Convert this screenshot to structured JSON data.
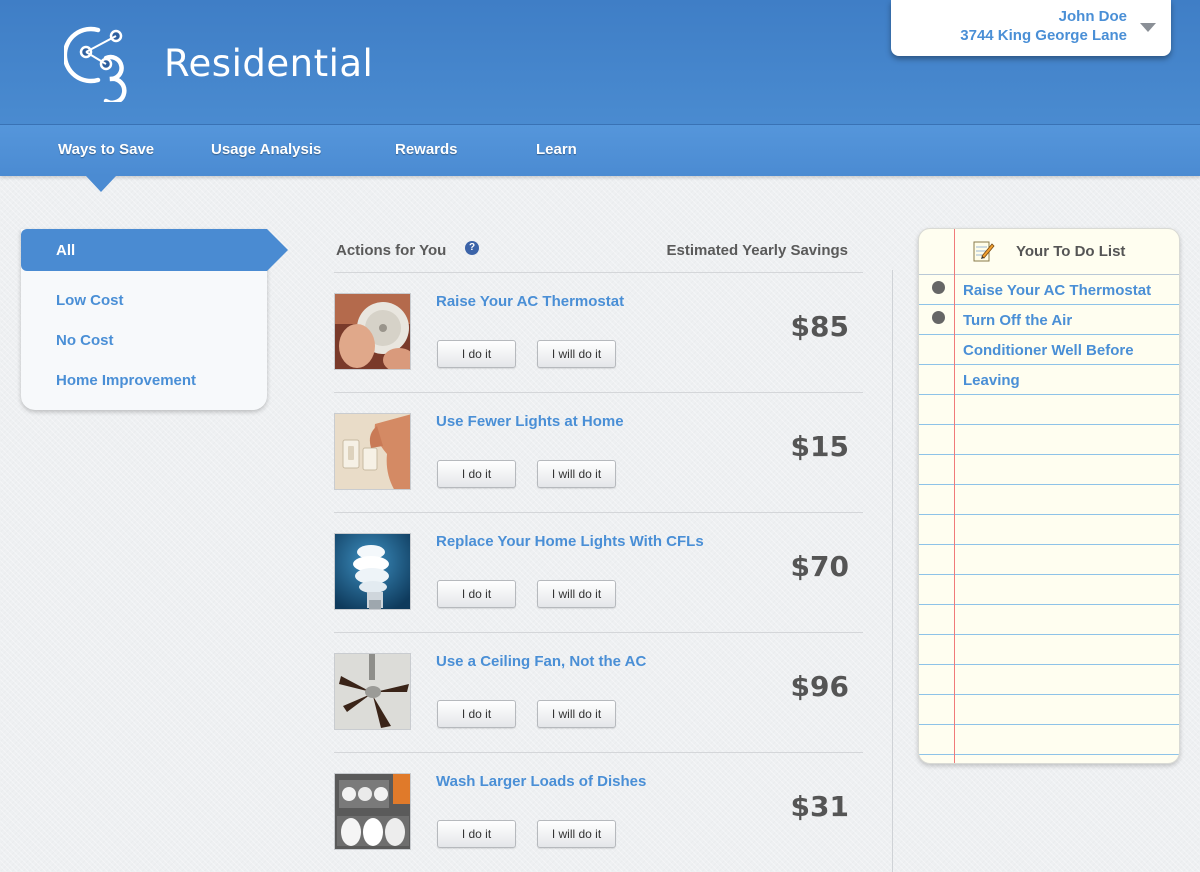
{
  "header": {
    "brand": "Residential",
    "user_name": "John Doe",
    "user_address": "3744 King George Lane"
  },
  "nav": {
    "items": [
      "Ways to Save",
      "Usage Analysis",
      "Rewards",
      "Learn"
    ],
    "active": "Ways to Save"
  },
  "filters": {
    "items": [
      "All",
      "Low Cost",
      "No Cost",
      "Home Improvement"
    ],
    "selected": "All"
  },
  "actions": {
    "header": "Actions for You",
    "savings_header": "Estimated Yearly Savings",
    "do_label": "I do it",
    "will_label": "I will do it",
    "items": [
      {
        "title": "Raise Your AC Thermostat",
        "savings": "$85",
        "image": "thermostat-image"
      },
      {
        "title": "Use Fewer Lights at Home",
        "savings": "$15",
        "image": "light-switch-image"
      },
      {
        "title": "Replace Your Home Lights With CFLs",
        "savings": "$70",
        "image": "cfl-bulb-image"
      },
      {
        "title": "Use a Ceiling Fan, Not the AC",
        "savings": "$96",
        "image": "ceiling-fan-image"
      },
      {
        "title": "Wash Larger Loads of Dishes",
        "savings": "$31",
        "image": "dishwasher-image"
      }
    ]
  },
  "todo": {
    "title": "Your To Do List",
    "lines": [
      "Raise Your AC Thermostat",
      "Turn Off the Air",
      "Conditioner Well Before",
      "Leaving"
    ]
  },
  "colors": {
    "header_blue": "#4a8bd0",
    "link_blue": "#4a8fd6",
    "notepad_bg": "#fffef0",
    "margin_red": "#f07a7a"
  }
}
